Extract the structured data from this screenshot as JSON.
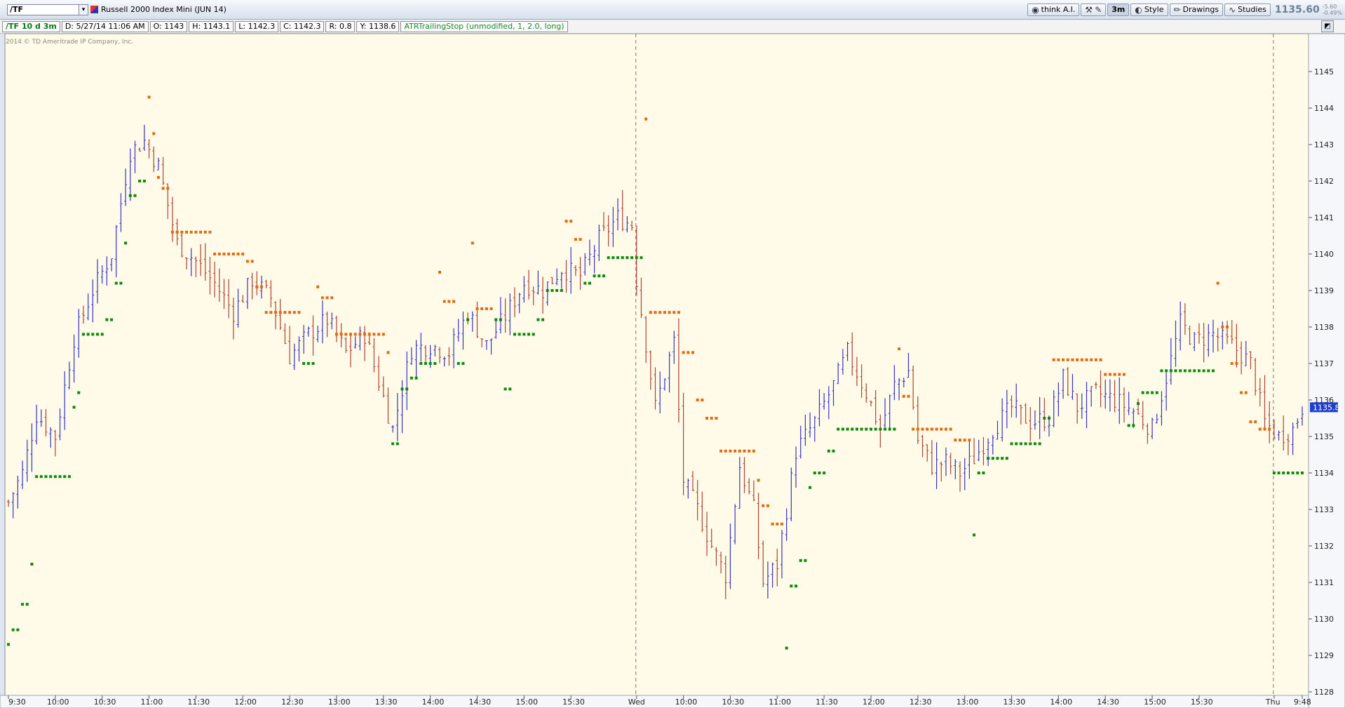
{
  "toolbar": {
    "symbol": "/TF",
    "instrument": "Russell 2000 Index Mini (JUN 14)",
    "think_label": "think A.I.",
    "timeframe": "3m",
    "style_label": "Style",
    "drawings_label": "Drawings",
    "studies_label": "Studies",
    "last_price": "1135.60",
    "net_change": "-5.60",
    "pct_change": "-0.49%"
  },
  "infobar": {
    "chart_label": "/TF 10 d 3m",
    "date": "D: 5/27/14 11:06 AM",
    "open": "O: 1143",
    "high": "H: 1143.1",
    "low": "L: 1142.3",
    "close": "C: 1142.3",
    "range": "R: 0.8",
    "y": "Y: 1138.6",
    "study": "ATRTrailingStop (unmodified, 1, 2.0, long)"
  },
  "copyright": "2014 © TD Ameritrade IP Company, Inc.",
  "colors": {
    "background": "#fffbe8",
    "up_bar": "#3535c0",
    "down_bar": "#b04030",
    "stop_long": "#0d8a0d",
    "stop_short": "#e06a10",
    "price_tag": "#1e3fc8"
  },
  "chart_data": {
    "type": "ohlc-bar",
    "symbol": "/TF",
    "interval": "3m",
    "y_range": [
      1128,
      1146
    ],
    "y_ticks": [
      1128,
      1129,
      1130,
      1131,
      1132,
      1133,
      1134,
      1135,
      1136,
      1137,
      1138,
      1139,
      1140,
      1141,
      1142,
      1143,
      1144,
      1145
    ],
    "x_ticks": [
      "9:30",
      "10:00",
      "10:30",
      "11:00",
      "11:30",
      "12:00",
      "12:30",
      "13:00",
      "13:30",
      "14:00",
      "14:30",
      "15:00",
      "15:30",
      "Wed",
      "10:00",
      "10:30",
      "11:00",
      "11:30",
      "12:00",
      "12:30",
      "13:00",
      "13:30",
      "14:00",
      "14:30",
      "15:00",
      "15:30",
      "Thu",
      "9:48"
    ],
    "x_tick_bars": [
      0,
      10,
      20,
      30,
      40,
      50,
      60,
      70,
      80,
      90,
      100,
      110,
      120,
      134,
      144,
      154,
      164,
      174,
      184,
      194,
      204,
      214,
      224,
      234,
      244,
      254,
      270,
      276
    ],
    "session_breaks": [
      134,
      270
    ],
    "current_price": "1135.8",
    "close_path": [
      [
        0,
        1133.2
      ],
      [
        3,
        1134.0
      ],
      [
        6,
        1135.6
      ],
      [
        10,
        1135.0
      ],
      [
        14,
        1137.7
      ],
      [
        18,
        1139.0
      ],
      [
        22,
        1140.0
      ],
      [
        26,
        1142.8
      ],
      [
        29,
        1143.1
      ],
      [
        32,
        1142.4
      ],
      [
        36,
        1140.3
      ],
      [
        40,
        1139.8
      ],
      [
        44,
        1139.2
      ],
      [
        48,
        1138.4
      ],
      [
        52,
        1139.3
      ],
      [
        56,
        1138.8
      ],
      [
        60,
        1137.2
      ],
      [
        64,
        1137.8
      ],
      [
        68,
        1138.2
      ],
      [
        72,
        1137.3
      ],
      [
        76,
        1137.8
      ],
      [
        79,
        1136.5
      ],
      [
        82,
        1135.2
      ],
      [
        86,
        1137.4
      ],
      [
        90,
        1137.5
      ],
      [
        94,
        1137.3
      ],
      [
        98,
        1138.4
      ],
      [
        102,
        1137.5
      ],
      [
        106,
        1138.3
      ],
      [
        110,
        1139.2
      ],
      [
        114,
        1139.0
      ],
      [
        118,
        1139.6
      ],
      [
        122,
        1139.4
      ],
      [
        126,
        1140.4
      ],
      [
        130,
        1141.0
      ],
      [
        133,
        1140.8
      ],
      [
        134,
        1139.3
      ],
      [
        138,
        1135.8
      ],
      [
        142,
        1137.6
      ],
      [
        144,
        1133.8
      ],
      [
        147,
        1133.0
      ],
      [
        150,
        1132.0
      ],
      [
        153,
        1131.2
      ],
      [
        156,
        1134.2
      ],
      [
        159,
        1133.0
      ],
      [
        161,
        1131.0
      ],
      [
        164,
        1131.5
      ],
      [
        166,
        1133.0
      ],
      [
        168,
        1134.6
      ],
      [
        172,
        1135.4
      ],
      [
        176,
        1136.4
      ],
      [
        179,
        1137.3
      ],
      [
        183,
        1136.2
      ],
      [
        186,
        1135.2
      ],
      [
        189,
        1136.4
      ],
      [
        192,
        1136.8
      ],
      [
        194,
        1134.9
      ],
      [
        197,
        1134.2
      ],
      [
        200,
        1134.3
      ],
      [
        203,
        1134.0
      ],
      [
        206,
        1134.4
      ],
      [
        210,
        1135.2
      ],
      [
        214,
        1135.8
      ],
      [
        218,
        1135.4
      ],
      [
        222,
        1135.5
      ],
      [
        225,
        1136.6
      ],
      [
        228,
        1135.8
      ],
      [
        232,
        1136.2
      ],
      [
        236,
        1136.0
      ],
      [
        240,
        1135.7
      ],
      [
        244,
        1135.2
      ],
      [
        248,
        1137.1
      ],
      [
        250,
        1138.1
      ],
      [
        253,
        1137.6
      ],
      [
        257,
        1137.8
      ],
      [
        261,
        1137.5
      ],
      [
        265,
        1137.0
      ],
      [
        268,
        1135.4
      ],
      [
        271,
        1135.0
      ],
      [
        274,
        1135.2
      ],
      [
        276,
        1135.8
      ]
    ],
    "atr_stop": [
      [
        0,
        1129.3,
        "long"
      ],
      [
        1,
        1129.7,
        "long"
      ],
      [
        3,
        1130.4,
        "long"
      ],
      [
        5,
        1131.5,
        "long"
      ],
      [
        6,
        1133.9,
        "long"
      ],
      [
        10,
        1133.9,
        "long"
      ],
      [
        14,
        1135.8,
        "long"
      ],
      [
        15,
        1136.2,
        "long"
      ],
      [
        16,
        1137.8,
        "long"
      ],
      [
        21,
        1138.2,
        "long"
      ],
      [
        23,
        1139.2,
        "long"
      ],
      [
        25,
        1140.3,
        "long"
      ],
      [
        26,
        1141.6,
        "long"
      ],
      [
        28,
        1142.0,
        "long"
      ],
      [
        30,
        1144.3,
        "short"
      ],
      [
        31,
        1143.3,
        "short"
      ],
      [
        32,
        1142.1,
        "short"
      ],
      [
        33,
        1141.8,
        "short"
      ],
      [
        35,
        1140.6,
        "short"
      ],
      [
        44,
        1140.0,
        "short"
      ],
      [
        51,
        1139.8,
        "short"
      ],
      [
        53,
        1139.1,
        "short"
      ],
      [
        55,
        1138.4,
        "short"
      ],
      [
        63,
        1137.0,
        "long"
      ],
      [
        66,
        1139.1,
        "short"
      ],
      [
        67,
        1138.8,
        "short"
      ],
      [
        70,
        1137.8,
        "short"
      ],
      [
        81,
        1137.3,
        "short"
      ],
      [
        82,
        1134.8,
        "long"
      ],
      [
        84,
        1136.3,
        "long"
      ],
      [
        86,
        1136.6,
        "long"
      ],
      [
        88,
        1137.0,
        "long"
      ],
      [
        92,
        1139.5,
        "short"
      ],
      [
        93,
        1138.7,
        "short"
      ],
      [
        96,
        1137.0,
        "long"
      ],
      [
        98,
        1138.2,
        "long"
      ],
      [
        99,
        1140.3,
        "short"
      ],
      [
        100,
        1138.5,
        "short"
      ],
      [
        104,
        1138.2,
        "long"
      ],
      [
        106,
        1136.3,
        "long"
      ],
      [
        108,
        1137.8,
        "long"
      ],
      [
        113,
        1138.2,
        "long"
      ],
      [
        115,
        1139.0,
        "long"
      ],
      [
        119,
        1140.9,
        "short"
      ],
      [
        121,
        1140.4,
        "short"
      ],
      [
        123,
        1139.2,
        "long"
      ],
      [
        125,
        1139.4,
        "long"
      ],
      [
        128,
        1139.9,
        "long"
      ],
      [
        136,
        1143.7,
        "short"
      ],
      [
        137,
        1138.4,
        "short"
      ],
      [
        144,
        1137.3,
        "short"
      ],
      [
        147,
        1136.0,
        "short"
      ],
      [
        149,
        1135.5,
        "short"
      ],
      [
        152,
        1134.6,
        "short"
      ],
      [
        160,
        1133.8,
        "short"
      ],
      [
        161,
        1133.1,
        "short"
      ],
      [
        163,
        1132.6,
        "short"
      ],
      [
        166,
        1129.2,
        "long"
      ],
      [
        167,
        1130.9,
        "long"
      ],
      [
        169,
        1131.6,
        "long"
      ],
      [
        171,
        1133.6,
        "long"
      ],
      [
        172,
        1134.0,
        "long"
      ],
      [
        175,
        1134.6,
        "long"
      ],
      [
        177,
        1135.2,
        "long"
      ],
      [
        190,
        1137.4,
        "short"
      ],
      [
        191,
        1136.1,
        "short"
      ],
      [
        193,
        1135.2,
        "short"
      ],
      [
        202,
        1134.9,
        "short"
      ],
      [
        206,
        1132.3,
        "long"
      ],
      [
        207,
        1134.0,
        "long"
      ],
      [
        209,
        1134.4,
        "long"
      ],
      [
        214,
        1134.8,
        "long"
      ],
      [
        221,
        1135.5,
        "long"
      ],
      [
        223,
        1137.1,
        "short"
      ],
      [
        234,
        1136.7,
        "short"
      ],
      [
        239,
        1135.3,
        "long"
      ],
      [
        241,
        1135.9,
        "long"
      ],
      [
        242,
        1136.2,
        "long"
      ],
      [
        246,
        1136.8,
        "long"
      ],
      [
        258,
        1139.2,
        "short"
      ],
      [
        259,
        1138.0,
        "short"
      ],
      [
        261,
        1137.0,
        "short"
      ],
      [
        263,
        1136.2,
        "short"
      ],
      [
        265,
        1135.4,
        "short"
      ],
      [
        267,
        1135.2,
        "short"
      ],
      [
        270,
        1134.0,
        "long"
      ]
    ]
  }
}
